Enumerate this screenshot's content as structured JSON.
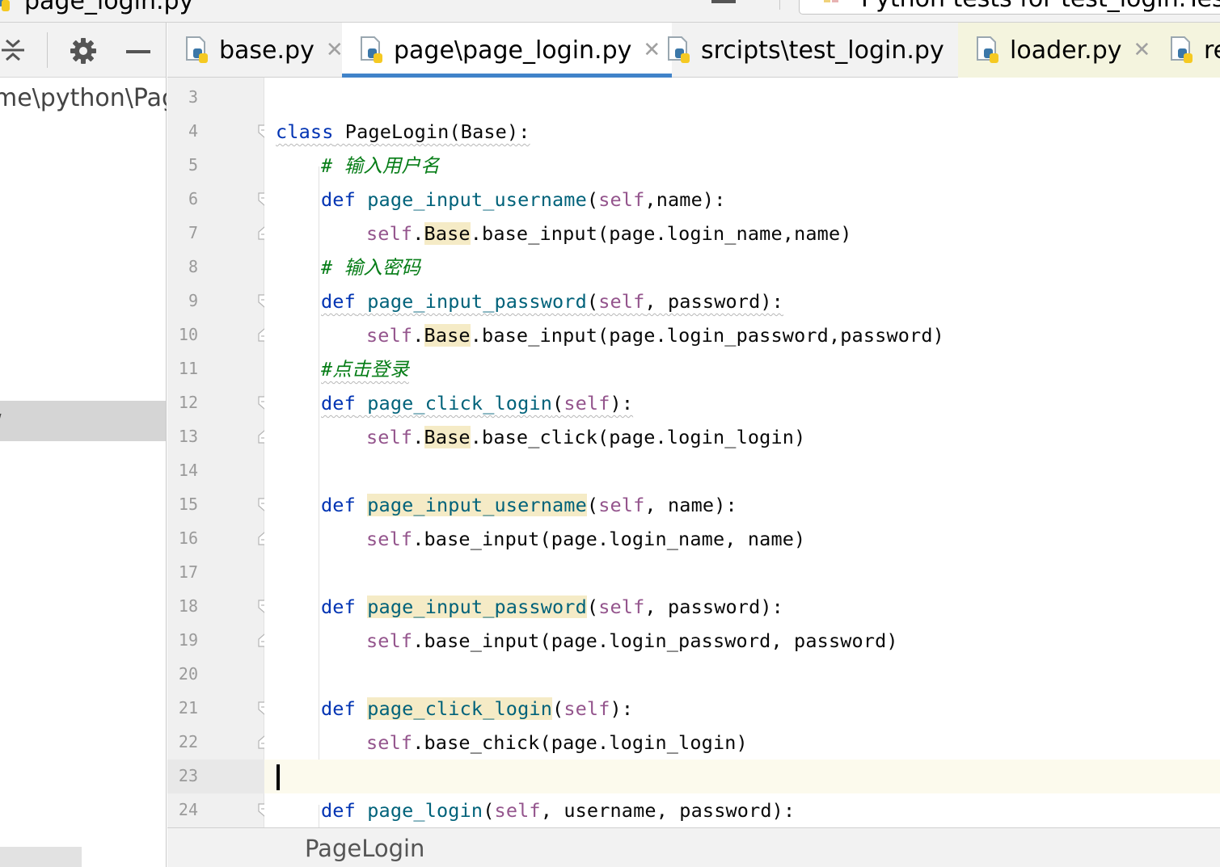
{
  "window": {
    "title_fragment": "page_login.py",
    "run_config_fragment": "Python tests for test_login.TestLo"
  },
  "project_panel": {
    "path_fragment": "me\\python\\Pag",
    "toolbar": {
      "collapse_icon": "collapse-all-icon",
      "settings_icon": "gear-icon",
      "hide_icon": "hide-panel-icon"
    }
  },
  "tabs": [
    {
      "label": "base.py",
      "active": false
    },
    {
      "label": "page\\page_login.py",
      "active": true
    },
    {
      "label": "srcipts\\test_login.py",
      "active": false
    },
    {
      "label": "loader.py",
      "active": false
    },
    {
      "label": "re",
      "active": false
    }
  ],
  "editor": {
    "current_line": 23,
    "lines": [
      {
        "n": "3"
      },
      {
        "n": "4"
      },
      {
        "n": "5"
      },
      {
        "n": "6"
      },
      {
        "n": "7"
      },
      {
        "n": "8"
      },
      {
        "n": "9"
      },
      {
        "n": "10"
      },
      {
        "n": "11"
      },
      {
        "n": "12"
      },
      {
        "n": "13"
      },
      {
        "n": "14"
      },
      {
        "n": "15"
      },
      {
        "n": "16"
      },
      {
        "n": "17"
      },
      {
        "n": "18"
      },
      {
        "n": "19"
      },
      {
        "n": "20"
      },
      {
        "n": "21"
      },
      {
        "n": "22"
      },
      {
        "n": "23"
      },
      {
        "n": "24"
      }
    ],
    "code": {
      "l4_kw": "class",
      "l4_rest": " PageLogin(Base):",
      "l5": "# 输入用户名",
      "l6_kw": "def",
      "l6_fn": "page_input_username",
      "l6_p1": "(",
      "l6_self": "self",
      "l6_p2": ",name):",
      "l7_self": "self",
      "l7_dot": ".",
      "l7_base": "Base",
      "l7_rest": ".base_input(page.login_name,name)",
      "l8": "# 输入密码",
      "l9_kw": "def",
      "l9_fn": "page_input_password",
      "l9_p1": "(",
      "l9_self": "self",
      "l9_p2": ", password):",
      "l10_self": "self",
      "l10_dot": ".",
      "l10_base": "Base",
      "l10_rest": ".base_input(page.login_password,password)",
      "l11": "#点击登录",
      "l12_kw": "def",
      "l12_fn": "page_click_login",
      "l12_p1": "(",
      "l12_self": "self",
      "l12_p2": "):",
      "l13_self": "self",
      "l13_dot": ".",
      "l13_base": "Base",
      "l13_rest": ".base_click(page.login_login)",
      "l15_kw": "def",
      "l15_fn": "page_input_username",
      "l15_p1": "(",
      "l15_self": "self",
      "l15_p2": ", name):",
      "l16_self": "self",
      "l16_rest": ".base_input(page.login_name, name)",
      "l18_kw": "def",
      "l18_fn": "page_input_password",
      "l18_p1": "(",
      "l18_self": "self",
      "l18_p2": ", password):",
      "l19_self": "self",
      "l19_rest": ".base_input(page.login_password, password)",
      "l21_kw": "def",
      "l21_fn": "page_click_login",
      "l21_p1": "(",
      "l21_self": "self",
      "l21_p2": "):",
      "l22_self": "self",
      "l22_rest": ".base_chick(page.login_login)",
      "l24_kw": "def",
      "l24_fn": "page_login",
      "l24_p1": "(",
      "l24_self": "self",
      "l24_p2": ", username, password):"
    }
  },
  "breadcrumb": {
    "items": [
      "PageLogin"
    ]
  },
  "colors": {
    "keyword": "#0033b3",
    "function": "#00627a",
    "self": "#94558d",
    "comment": "#067d17",
    "identifier_highlight": "#f5ebc6",
    "active_tab_underline": "#4083c9",
    "current_line": "#fcfaed"
  }
}
